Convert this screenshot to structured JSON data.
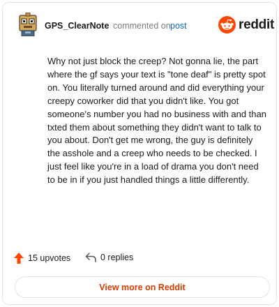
{
  "header": {
    "username": "GPS_ClearNote",
    "action_text": "commented on",
    "post_link": "post",
    "logo_text": "reddit"
  },
  "comment": {
    "body": "Why not just block the creep? Not gonna lie, the part where the gf says your text is \"tone deaf\" is pretty spot on. You literally turned around and did everything your creepy coworker did that you didn't like. You got someone's number you had no business with and than txted them about something they didn't want to talk to you about. Don't get me wrong, the guy is definitely the asshole and a creep who needs to be checked. I just feel like you're in a load of drama you don't need to be in if you just handled things a little differently."
  },
  "footer": {
    "upvotes_label": "15 upvotes",
    "replies_label": "0 replies",
    "view_more_label": "View more on Reddit"
  },
  "colors": {
    "brand": "#ff4500",
    "link": "#0a66c2",
    "view_more": "#d93a00"
  },
  "icons": {
    "avatar": "pixel-robot-avatar-icon",
    "logo": "reddit-snoo-icon",
    "upvote": "upvote-arrow-icon",
    "reply": "reply-arrow-icon"
  }
}
